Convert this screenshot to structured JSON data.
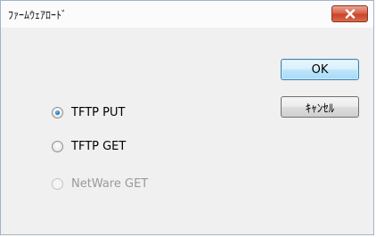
{
  "window": {
    "title": "ﾌｧｰﾑｳｪｱﾛｰﾄﾞ",
    "close_icon": "close-icon"
  },
  "buttons": {
    "ok_label": "OK",
    "cancel_label": "ｷｬﾝｾﾙ"
  },
  "options": [
    {
      "label": "TFTP PUT",
      "checked": true,
      "enabled": true
    },
    {
      "label": "TFTP GET",
      "checked": false,
      "enabled": true
    },
    {
      "label": "NetWare GET",
      "checked": false,
      "enabled": false
    }
  ],
  "colors": {
    "close_button": "#c84528",
    "radio_selected": "#1c6fb4",
    "disabled_text": "#9a9a9a"
  }
}
